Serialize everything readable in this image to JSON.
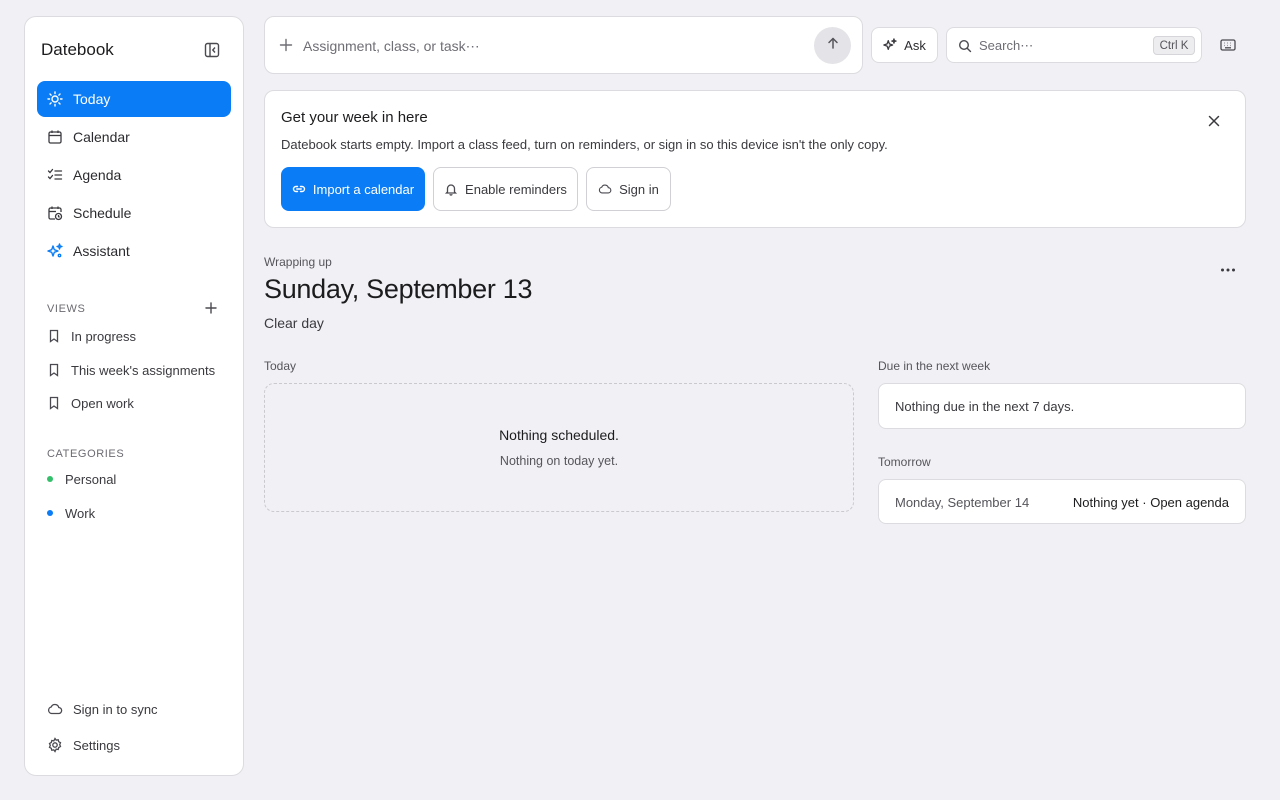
{
  "app": {
    "title": "Datebook"
  },
  "sidebar": {
    "nav": [
      {
        "label": "Today",
        "icon": "sun-icon",
        "active": true
      },
      {
        "label": "Calendar",
        "icon": "calendar-icon"
      },
      {
        "label": "Agenda",
        "icon": "list-check-icon"
      },
      {
        "label": "Schedule",
        "icon": "calendar-clock-icon"
      },
      {
        "label": "Assistant",
        "icon": "sparkles-icon"
      }
    ],
    "views_label": "VIEWS",
    "views": [
      {
        "label": "In progress"
      },
      {
        "label": "This week's assignments"
      },
      {
        "label": "Open work"
      }
    ],
    "categories_label": "CATEGORIES",
    "categories": [
      {
        "label": "Personal",
        "color": "#34c06a"
      },
      {
        "label": "Work",
        "color": "#0a7cf5"
      }
    ],
    "footer": {
      "sync_label": "Sign in to sync",
      "settings_label": "Settings"
    }
  },
  "topbar": {
    "quickadd_placeholder": "Assignment, class, or task⋯",
    "ask_label": "Ask",
    "search_placeholder": "Search⋯",
    "search_shortcut": "Ctrl K"
  },
  "banner": {
    "title": "Get your week in here",
    "text": "Datebook starts empty. Import a class feed, turn on reminders, or sign in so this device isn't the only copy.",
    "import_label": "Import a calendar",
    "reminders_label": "Enable reminders",
    "signin_label": "Sign in"
  },
  "day": {
    "eyebrow": "Wrapping up",
    "title": "Sunday, September 13",
    "subtitle": "Clear day"
  },
  "today": {
    "label": "Today",
    "empty_title": "Nothing scheduled.",
    "empty_sub": "Nothing on today yet."
  },
  "next_week": {
    "label": "Due in the next week",
    "text": "Nothing due in the next 7 days."
  },
  "tomorrow": {
    "label": "Tomorrow",
    "date": "Monday, September 14",
    "link": "Nothing yet · Open agenda"
  },
  "colors": {
    "accent": "#0a7cf5",
    "background": "#f1f1f5"
  }
}
